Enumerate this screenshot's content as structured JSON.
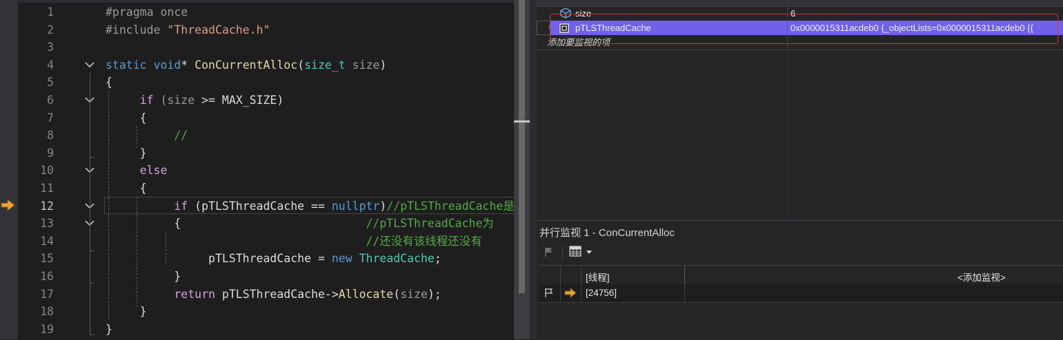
{
  "editor": {
    "current_line": 12,
    "lines": [
      {
        "n": "1",
        "segs": [
          [
            "pp",
            "#pragma once"
          ]
        ]
      },
      {
        "n": "2",
        "segs": [
          [
            "pp",
            "#include "
          ],
          [
            "str",
            "\"ThreadCache.h\""
          ]
        ]
      },
      {
        "n": "3",
        "segs": []
      },
      {
        "n": "4",
        "segs": [
          [
            "k",
            "static"
          ],
          [
            "",
            " "
          ],
          [
            "k",
            "void"
          ],
          [
            "",
            "* "
          ],
          [
            "fn",
            "ConCurrentAlloc"
          ],
          [
            "",
            "("
          ],
          [
            "ty",
            "size_t"
          ],
          [
            "",
            " "
          ],
          [
            "pa",
            "size"
          ],
          [
            "",
            ")"
          ]
        ]
      },
      {
        "n": "5",
        "segs": [
          [
            "",
            "{"
          ]
        ]
      },
      {
        "n": "6",
        "segs": [
          [
            "",
            "     "
          ],
          [
            "c",
            "if"
          ],
          [
            "pa",
            " (size "
          ],
          [
            "",
            ">= MAX_SIZE)"
          ]
        ]
      },
      {
        "n": "7",
        "segs": [
          [
            "",
            "     {"
          ]
        ]
      },
      {
        "n": "8",
        "segs": [
          [
            "",
            "          "
          ],
          [
            "cm",
            "//"
          ]
        ]
      },
      {
        "n": "9",
        "segs": [
          [
            "",
            "     }"
          ]
        ]
      },
      {
        "n": "10",
        "segs": [
          [
            "",
            "     "
          ],
          [
            "c",
            "else"
          ]
        ]
      },
      {
        "n": "11",
        "segs": [
          [
            "",
            "     {"
          ]
        ]
      },
      {
        "n": "12",
        "segs": [
          [
            "",
            "          "
          ],
          [
            "c",
            "if"
          ],
          [
            "",
            " (pTLSThreadCache == "
          ],
          [
            "k",
            "nullptr"
          ],
          [
            "",
            ")"
          ],
          [
            "cm",
            "//pTLSThreadCache是"
          ]
        ]
      },
      {
        "n": "13",
        "segs": [
          [
            "",
            "          {                           "
          ],
          [
            "cm",
            "//pTLSThreadCache为"
          ]
        ]
      },
      {
        "n": "14",
        "segs": [
          [
            "",
            "                                      "
          ],
          [
            "cm",
            "//还没有该线程还没有"
          ]
        ]
      },
      {
        "n": "15",
        "segs": [
          [
            "",
            "               pTLSThreadCache = "
          ],
          [
            "k",
            "new"
          ],
          [
            "",
            " "
          ],
          [
            "ty",
            "ThreadCache"
          ],
          [
            "",
            ";"
          ]
        ]
      },
      {
        "n": "16",
        "segs": [
          [
            "",
            "          }"
          ]
        ]
      },
      {
        "n": "17",
        "segs": [
          [
            "",
            "          "
          ],
          [
            "c",
            "return"
          ],
          [
            "",
            " pTLSThreadCache->"
          ],
          [
            "fn",
            "Allocate"
          ],
          [
            "",
            "("
          ],
          [
            "pa",
            "size"
          ],
          [
            "",
            ");"
          ]
        ]
      },
      {
        "n": "18",
        "segs": [
          [
            "",
            "     }"
          ]
        ]
      },
      {
        "n": "19",
        "segs": [
          [
            "",
            "}"
          ]
        ]
      }
    ],
    "folds": [
      "4",
      "6",
      "10",
      "12",
      "13"
    ]
  },
  "watch": {
    "rows": [
      {
        "name": "size",
        "value": "6"
      },
      {
        "name": "pTLSThreadCache",
        "value": "0x0000015311acdeb0 {_objectLists=0x0000015311acdeb0 {{"
      }
    ],
    "placeholder": "添加要监视的项"
  },
  "parallel_watch": {
    "title": "并行监视 1 - ConCurrentAlloc",
    "col_thread": "[线程]",
    "col_add": "<添加监视>",
    "thread_id": "[24756]"
  },
  "colors": {
    "selection": "#7160e8",
    "highlight_border": "#c8373a",
    "exec_arrow": "#e8a33d"
  }
}
